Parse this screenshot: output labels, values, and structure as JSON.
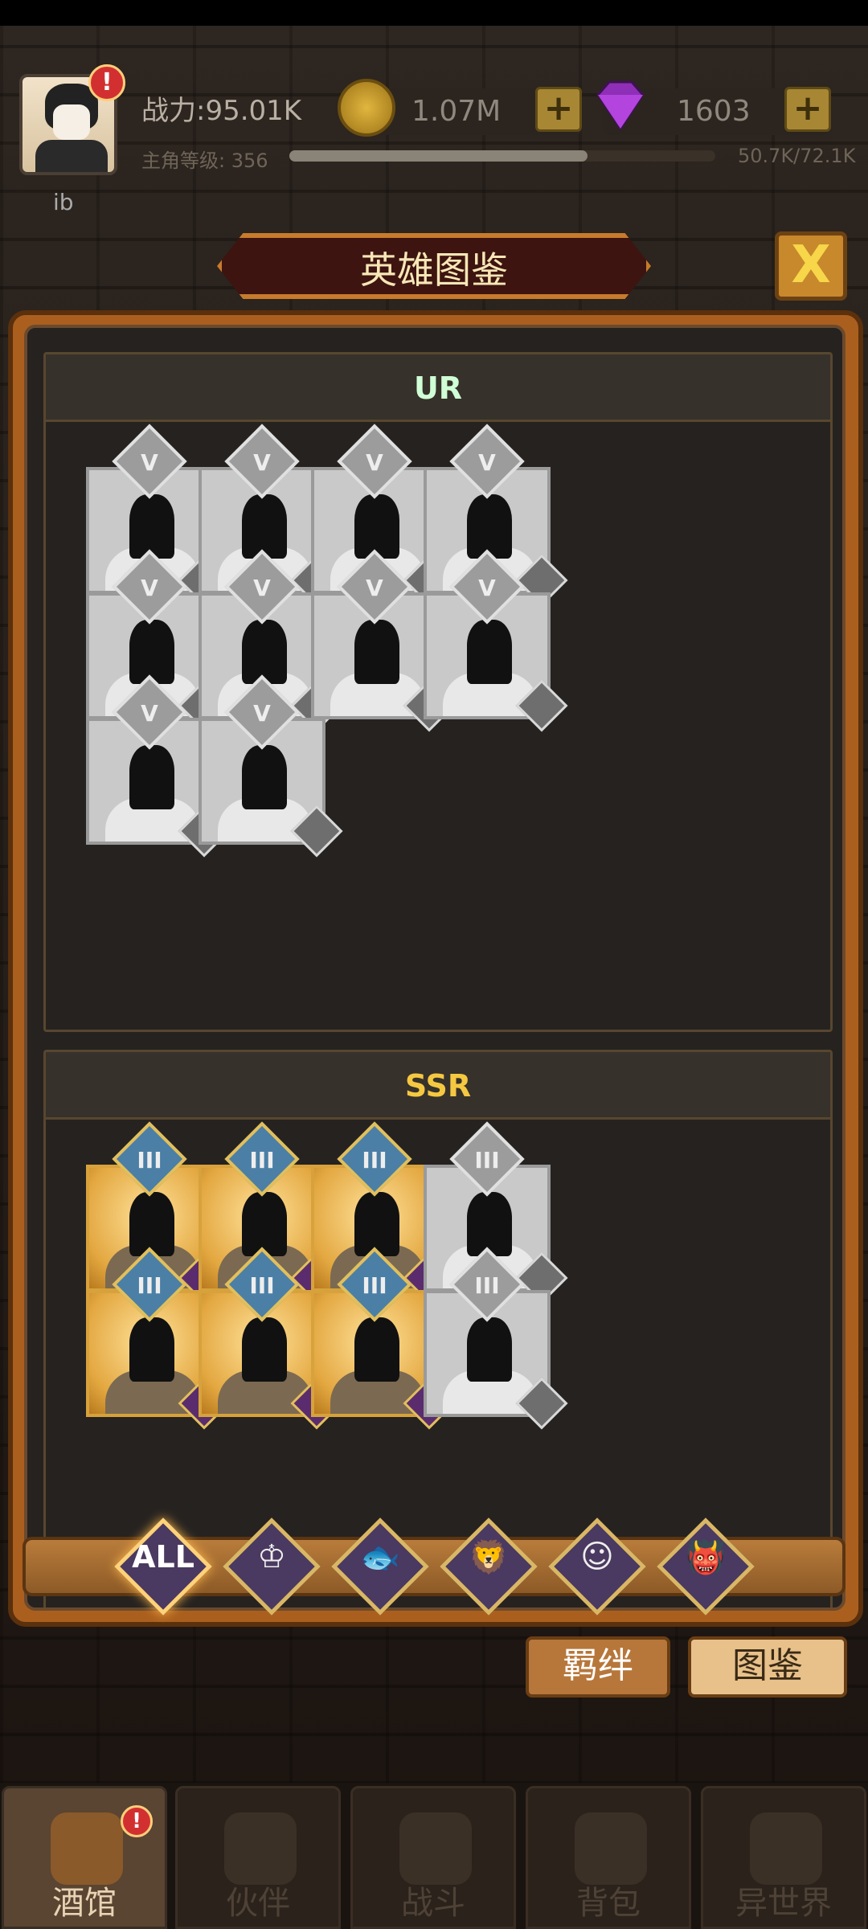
{
  "header": {
    "player_name": "ib",
    "power": "战力:95.01K",
    "level_label": "主角等级: 356",
    "level_progress": "50.7K/72.1K",
    "level_fraction": 0.7,
    "gold": "1.07M",
    "gems": "1603",
    "plus": "+",
    "alert": "!"
  },
  "panel": {
    "title": "英雄图鉴",
    "close": "X",
    "sections": [
      {
        "name": "UR",
        "color": "#d0ffd6",
        "tier_badge": "V"
      },
      {
        "name": "SSR",
        "color": "#f5c842",
        "tier_badge": "III"
      }
    ]
  },
  "filters": {
    "all": "ALL",
    "icons": [
      "knight-faction-icon",
      "fish-faction-icon",
      "lion-faction-icon",
      "elf-faction-icon",
      "demon-faction-icon"
    ]
  },
  "buttons": {
    "bond": "羁绊",
    "codex": "图鉴"
  },
  "nav": {
    "items": [
      "酒馆",
      "伙伴",
      "战斗",
      "背包",
      "异世界"
    ],
    "active": "酒馆"
  },
  "colors": {
    "frame_orange": "#ab5f1e",
    "gold_accent": "#d7a23c",
    "ur_label": "#d0ffd6",
    "ssr_label": "#f5c842"
  }
}
